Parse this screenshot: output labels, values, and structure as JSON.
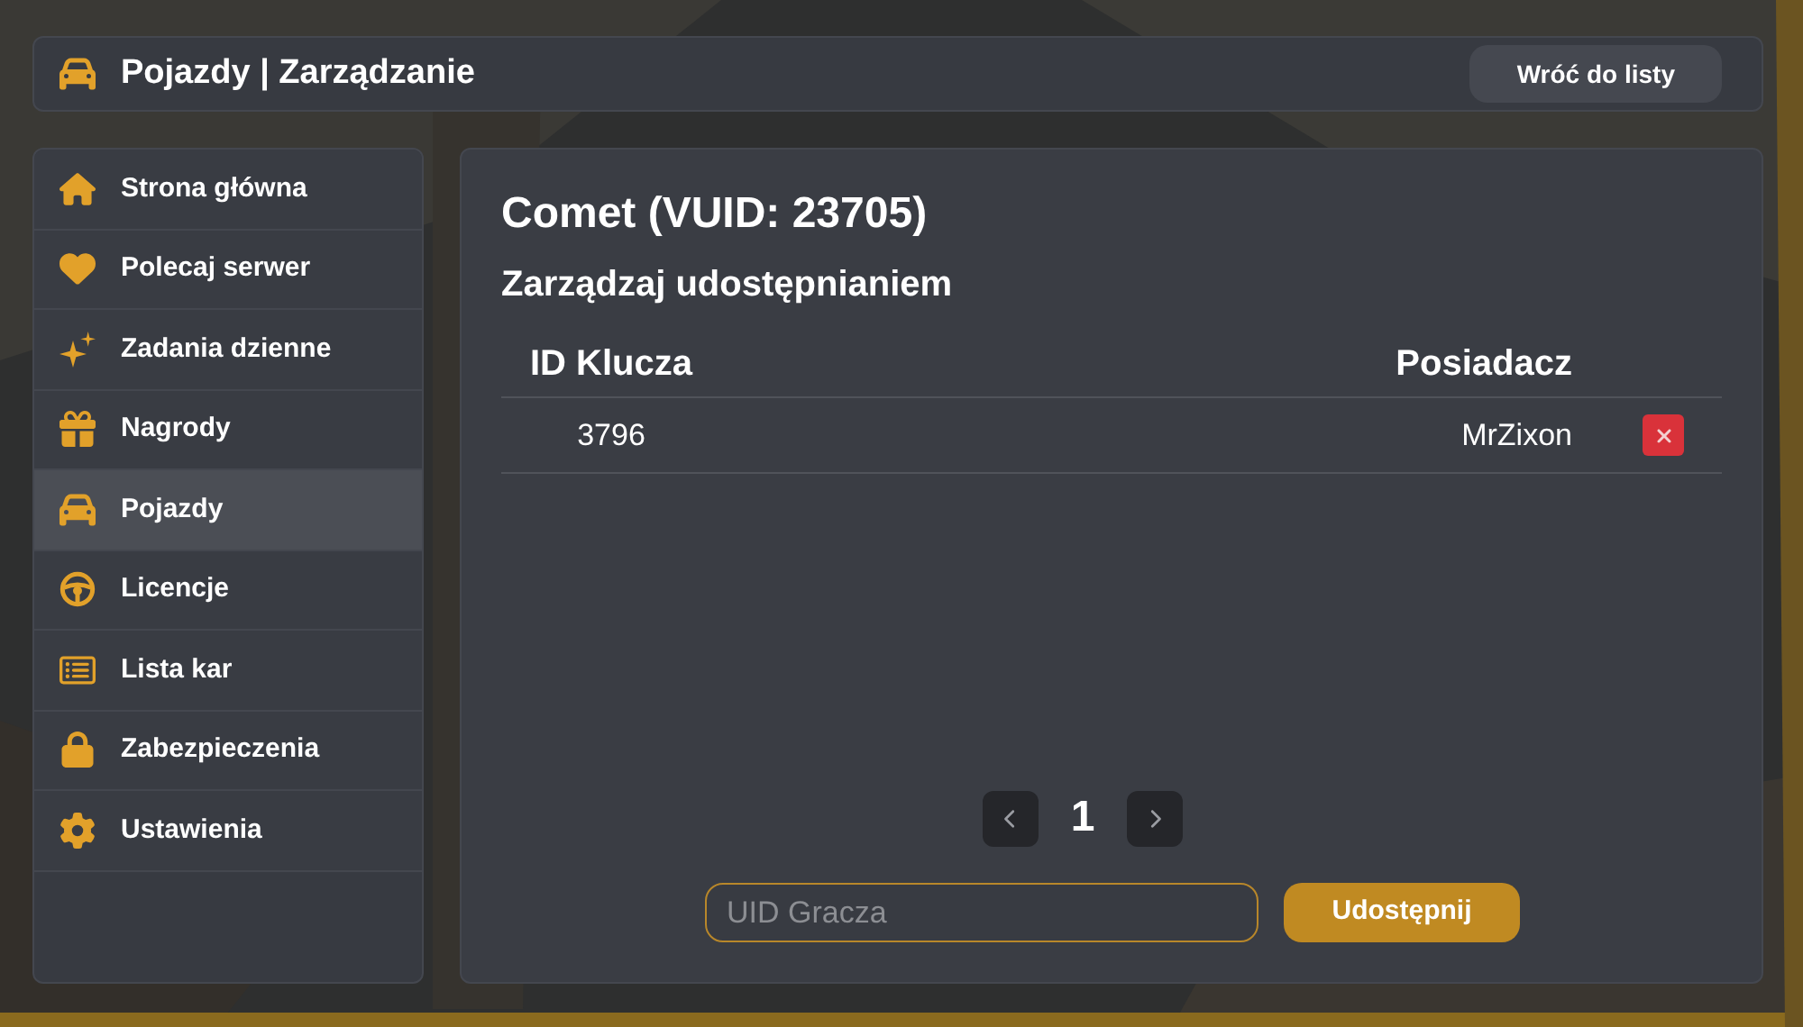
{
  "header": {
    "title": "Pojazdy | Zarządzanie",
    "back_button": "Wróć do listy"
  },
  "sidebar": {
    "items": [
      {
        "label": "Strona główna",
        "selected": false
      },
      {
        "label": "Polecaj serwer",
        "selected": false
      },
      {
        "label": "Zadania dzienne",
        "selected": false
      },
      {
        "label": "Nagrody",
        "selected": false
      },
      {
        "label": "Pojazdy",
        "selected": true
      },
      {
        "label": "Licencje",
        "selected": false
      },
      {
        "label": "Lista kar",
        "selected": false
      },
      {
        "label": "Zabezpieczenia",
        "selected": false
      },
      {
        "label": "Ustawienia",
        "selected": false
      }
    ]
  },
  "main": {
    "title": "Comet (VUID: 23705)",
    "subtitle": "Zarządzaj udostępnianiem",
    "table": {
      "columns": [
        "ID Klucza",
        "Posiadacz"
      ],
      "rows": [
        {
          "key_id": "3796",
          "owner": "MrZixon"
        }
      ]
    },
    "pagination": {
      "page": "1"
    },
    "share_form": {
      "placeholder": "UID Gracza",
      "button": "Udostępnij"
    }
  }
}
